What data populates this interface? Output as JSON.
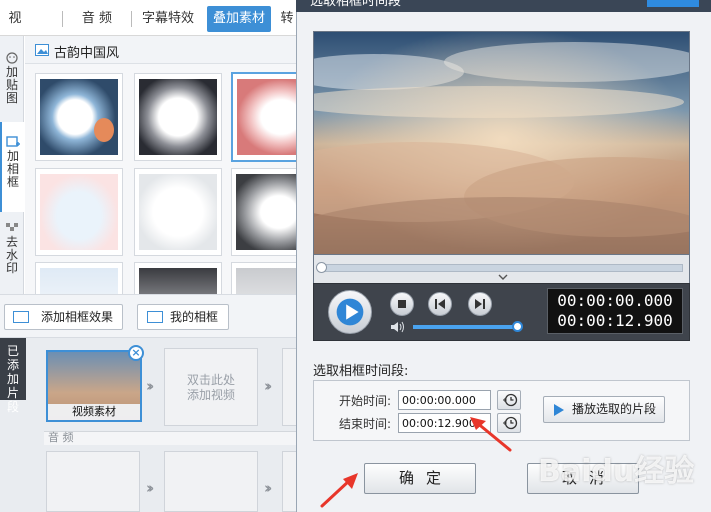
{
  "nav": {
    "tabs": [
      {
        "label": "视 频"
      },
      {
        "label": "音 频"
      },
      {
        "label": "字幕特效"
      },
      {
        "label": "叠加素材"
      },
      {
        "label": "转"
      }
    ],
    "active_index": 3
  },
  "sidebar": {
    "items": [
      {
        "label": "加贴图",
        "icon": "sticker-icon"
      },
      {
        "label": "加相框",
        "icon": "frame-add-icon"
      },
      {
        "label": "去水印",
        "icon": "watermark-remove-icon"
      }
    ],
    "active_index": 1
  },
  "materials": {
    "category_title": "古韵中国风",
    "thumbnail_count": 9,
    "selected_index": 2
  },
  "actions": {
    "add_frame_label": "添加相框效果",
    "my_frames_label": "我的相框"
  },
  "timeline": {
    "added_tab_label": "已添加片段",
    "clip_label": "视频素材",
    "placeholder_text": "双击此处添加视频",
    "audio_track_label": "音 频"
  },
  "dialog": {
    "title": "选取相框时间段",
    "player": {
      "current_time": "00:00:00.000",
      "total_time": "00:00:12.900",
      "volume_fraction": 0.97,
      "progress_fraction": 0.0
    },
    "section_title": "选取相框时间段:",
    "start_label": "开始时间:",
    "start_value": "00:00:00.000",
    "end_label": "结束时间:",
    "end_value": "00:00:12.900",
    "play_segment_label": "播放选取的片段",
    "ok_label": "确定",
    "cancel_label": "取消"
  },
  "watermark_text": "Baidu经验",
  "colors": {
    "accent": "#3d8fd6",
    "annotation_arrow": "#e8362a",
    "player_bar": "#3f444c"
  }
}
